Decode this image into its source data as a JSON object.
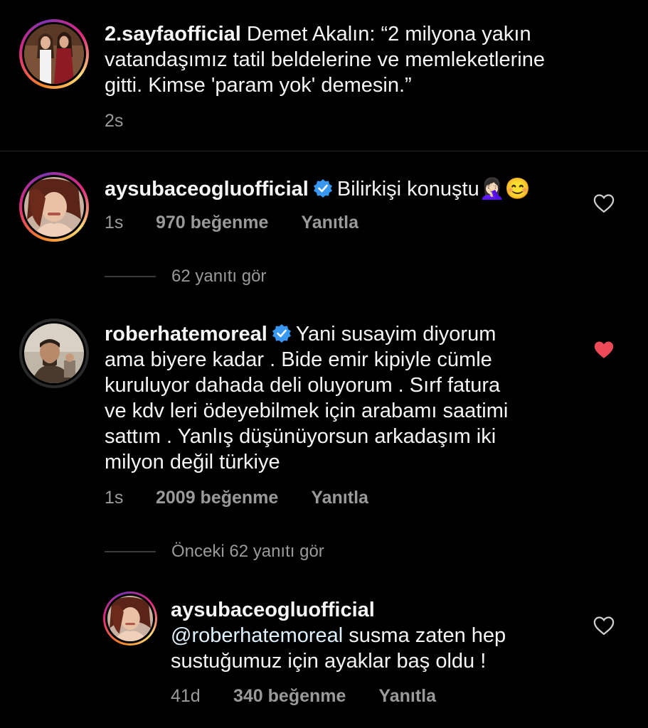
{
  "post": {
    "username": "2.sayfaofficial",
    "caption_line1": "Demet Akalın: “2 milyona yakın",
    "caption_line2": "vatandaşımız tatil beldelerine ve memleketlerine",
    "caption_line3": "gitti. Kimse 'param yok' demesin.”",
    "time": "2s"
  },
  "comments": [
    {
      "username": "aysubaceogluofficial",
      "verified": true,
      "text": "Bilirkişi konuştu🤦🏻‍♀️😊",
      "time": "1s",
      "likes": "970 beğenme",
      "reply_label": "Yanıtla",
      "liked": false,
      "view_replies": "62 yanıtı gör"
    },
    {
      "username": "roberhatemoreal",
      "verified": true,
      "text_line1": "Yani susayim diyorum",
      "text_line2": "ama biyere kadar . Bide emir kipiyle cümle",
      "text_line3": "kuruluyor dahada deli oluyorum . Sırf fatura",
      "text_line4": "ve kdv leri ödeyebilmek için arabamı saatimi",
      "text_line5": "sattım . Yanlış düşünüyorsun arkadaşım iki",
      "text_line6": "milyon değil türkiye",
      "time": "1s",
      "likes": "2009 beğenme",
      "reply_label": "Yanıtla",
      "liked": true,
      "view_replies": "Önceki 62 yanıtı gör"
    }
  ],
  "reply": {
    "username": "aysubaceogluofficial",
    "mention": "@roberhatemoreal",
    "text_line1": "susma zaten hep",
    "text_line2": "sustuğumuz için ayaklar baş oldu !",
    "time": "41d",
    "likes": "340 beğenme",
    "reply_label": "Yanıtla",
    "liked": false
  },
  "colors": {
    "background": "#000000",
    "verified_blue": "#3897f0",
    "liked_red": "#ed4956",
    "secondary_text": "#9a9a9a"
  }
}
